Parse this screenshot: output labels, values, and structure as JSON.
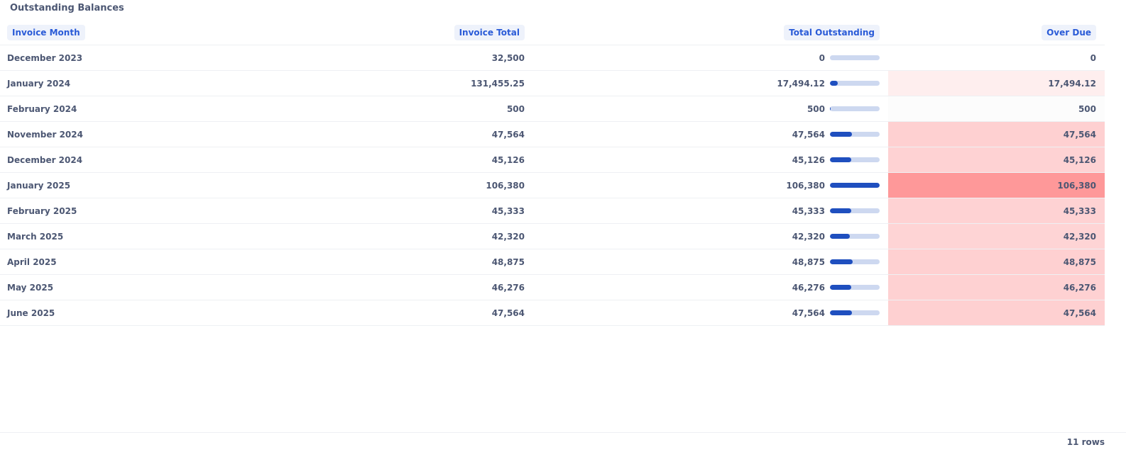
{
  "title": "Outstanding Balances",
  "columns": {
    "month": "Invoice Month",
    "invoice_total": "Invoice Total",
    "total_outstanding": "Total Outstanding",
    "over_due": "Over Due"
  },
  "rows": [
    {
      "month": "December 2023",
      "invoice_total": "32,500",
      "total_outstanding": "0",
      "over_due": "0",
      "outstanding_ratio": 0.0,
      "overdue_color": "#ffffff"
    },
    {
      "month": "January 2024",
      "invoice_total": "131,455.25",
      "total_outstanding": "17,494.12",
      "over_due": "17,494.12",
      "outstanding_ratio": 0.164,
      "overdue_color": "#feeeee"
    },
    {
      "month": "February 2024",
      "invoice_total": "500",
      "total_outstanding": "500",
      "over_due": "500",
      "outstanding_ratio": 0.005,
      "overdue_color": "#fcfcfc"
    },
    {
      "month": "November 2024",
      "invoice_total": "47,564",
      "total_outstanding": "47,564",
      "over_due": "47,564",
      "outstanding_ratio": 0.447,
      "overdue_color": "#fed0d1"
    },
    {
      "month": "December 2024",
      "invoice_total": "45,126",
      "total_outstanding": "45,126",
      "over_due": "45,126",
      "outstanding_ratio": 0.424,
      "overdue_color": "#fed2d3"
    },
    {
      "month": "January 2025",
      "invoice_total": "106,380",
      "total_outstanding": "106,380",
      "over_due": "106,380",
      "outstanding_ratio": 1.0,
      "overdue_color": "#fe9899"
    },
    {
      "month": "February 2025",
      "invoice_total": "45,333",
      "total_outstanding": "45,333",
      "over_due": "45,333",
      "outstanding_ratio": 0.426,
      "overdue_color": "#fed2d3"
    },
    {
      "month": "March 2025",
      "invoice_total": "42,320",
      "total_outstanding": "42,320",
      "over_due": "42,320",
      "outstanding_ratio": 0.398,
      "overdue_color": "#fed4d5"
    },
    {
      "month": "April 2025",
      "invoice_total": "48,875",
      "total_outstanding": "48,875",
      "over_due": "48,875",
      "outstanding_ratio": 0.459,
      "overdue_color": "#fed0d1"
    },
    {
      "month": "May 2025",
      "invoice_total": "46,276",
      "total_outstanding": "46,276",
      "over_due": "46,276",
      "outstanding_ratio": 0.435,
      "overdue_color": "#fed1d2"
    },
    {
      "month": "June 2025",
      "invoice_total": "47,564",
      "total_outstanding": "47,564",
      "over_due": "47,564",
      "outstanding_ratio": 0.447,
      "overdue_color": "#fed0d1"
    }
  ],
  "row_count": "11 rows",
  "colors": {
    "header_text": "#2a5bd7",
    "header_bg": "#eef2fb",
    "bar_fill": "#1f4fbf",
    "bar_track": "#cdd8f0",
    "text": "#4c5773"
  }
}
